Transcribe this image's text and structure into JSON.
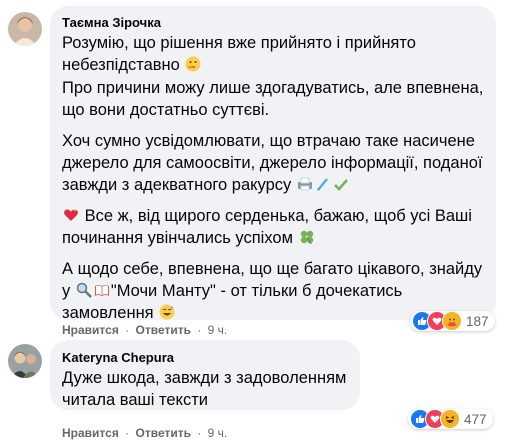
{
  "comments": [
    {
      "author": "Таємна Зірочка",
      "paragraphs": [
        [
          "Розумію, що рішення вже прийнято і прийнято небезпідставно",
          "Про причини можу лише здогадуватись, але впевнена, що вони достатньо суттєві."
        ],
        "Хоч сумно усвідомлювати, що втрачаю таке насичене джерело для самоосвіти, джерело інформації, поданої завжди з адекватного ракурсу",
        "Все ж, від щирого серденька, бажаю, щоб усі Ваші починання увінчались успіхом",
        {
          "pre": "А щодо себе, впевнена, що ще багато цікавого, знайду у ",
          "quote": "\"Мочи Манту\"",
          "post": " - от тільки б дочекатись замовлення"
        }
      ],
      "actions": {
        "like": "Нравится",
        "reply": "Ответить",
        "sep": "·",
        "time": "9 ч."
      },
      "reaction_count": "187",
      "reactions": [
        "like-reaction",
        "love-reaction",
        "care-reaction"
      ]
    },
    {
      "author": "Kateryna Chepura",
      "paragraphs": [
        "Дуже шкода, завжди з задоволенням читала ваші тексти"
      ],
      "actions": {
        "like": "Нравится",
        "reply": "Ответить",
        "sep": "·",
        "time": "9 ч."
      },
      "reaction_count": "477",
      "reactions": [
        "like-reaction",
        "love-reaction",
        "haha-reaction"
      ]
    }
  ],
  "colors": {
    "bubble": "#f0f2f5",
    "meta": "#65676b",
    "like": "#1877f2",
    "love": "#f33e58",
    "care": "#f7b125"
  }
}
